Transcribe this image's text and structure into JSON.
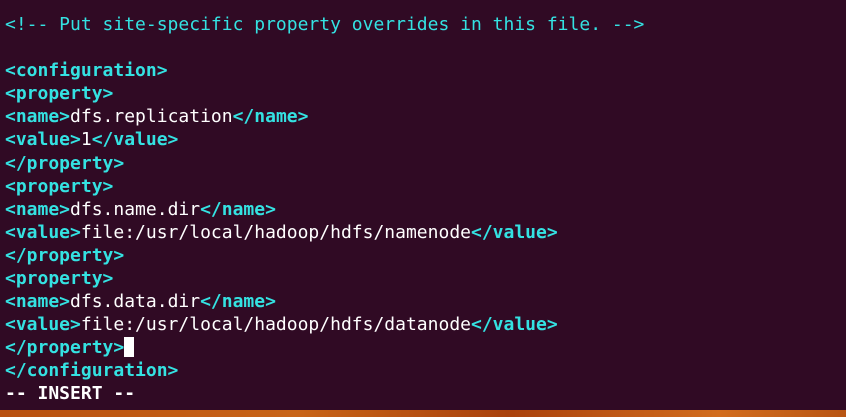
{
  "editor": {
    "mode": "INSERT",
    "lines": [
      {
        "segments": [
          {
            "kind": "comment",
            "text": "<!-- Put site-specific property overrides in this file. -->"
          }
        ]
      },
      {
        "segments": []
      },
      {
        "segments": [
          {
            "kind": "tag",
            "text": "<configuration>"
          }
        ]
      },
      {
        "segments": [
          {
            "kind": "tag",
            "text": "<property>"
          }
        ]
      },
      {
        "segments": [
          {
            "kind": "tag",
            "text": "<name>"
          },
          {
            "kind": "text",
            "text": "dfs.replication"
          },
          {
            "kind": "tag",
            "text": "</name>"
          }
        ]
      },
      {
        "segments": [
          {
            "kind": "tag",
            "text": "<value>"
          },
          {
            "kind": "text",
            "text": "1"
          },
          {
            "kind": "tag",
            "text": "</value>"
          }
        ]
      },
      {
        "segments": [
          {
            "kind": "tag",
            "text": "</property>"
          }
        ]
      },
      {
        "segments": [
          {
            "kind": "tag",
            "text": "<property>"
          }
        ]
      },
      {
        "segments": [
          {
            "kind": "tag",
            "text": "<name>"
          },
          {
            "kind": "text",
            "text": "dfs.name.dir"
          },
          {
            "kind": "tag",
            "text": "</name>"
          }
        ]
      },
      {
        "segments": [
          {
            "kind": "tag",
            "text": "<value>"
          },
          {
            "kind": "text",
            "text": "file:/usr/local/hadoop/hdfs/namenode"
          },
          {
            "kind": "tag",
            "text": "</value>"
          }
        ]
      },
      {
        "segments": [
          {
            "kind": "tag",
            "text": "</property>"
          }
        ]
      },
      {
        "segments": [
          {
            "kind": "tag",
            "text": "<property>"
          }
        ]
      },
      {
        "segments": [
          {
            "kind": "tag",
            "text": "<name>"
          },
          {
            "kind": "text",
            "text": "dfs.data.dir"
          },
          {
            "kind": "tag",
            "text": "</name>"
          }
        ]
      },
      {
        "segments": [
          {
            "kind": "tag",
            "text": "<value>"
          },
          {
            "kind": "text",
            "text": "file:/usr/local/hadoop/hdfs/datanode"
          },
          {
            "kind": "tag",
            "text": "</value>"
          }
        ]
      },
      {
        "segments": [
          {
            "kind": "tag",
            "text": "</property>"
          },
          {
            "kind": "cursor",
            "text": ""
          }
        ]
      },
      {
        "segments": [
          {
            "kind": "tag",
            "text": "</configuration>"
          }
        ]
      }
    ],
    "status_line": "-- INSERT --"
  },
  "colors": {
    "background": "#300a24",
    "tag": "#34e2e2",
    "text": "#ffffff"
  }
}
